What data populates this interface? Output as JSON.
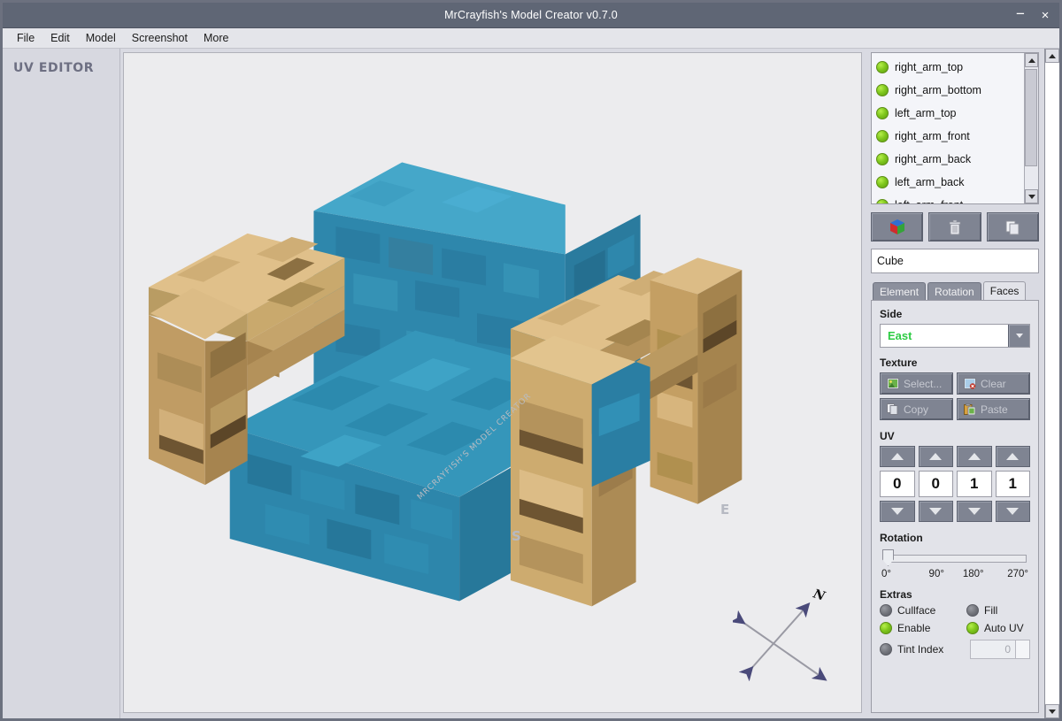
{
  "window": {
    "title": "MrCrayfish's Model Creator v0.7.0",
    "minimize": "−",
    "close": "×"
  },
  "menubar": {
    "items": [
      {
        "label": "File"
      },
      {
        "label": "Edit"
      },
      {
        "label": "Model"
      },
      {
        "label": "Screenshot"
      },
      {
        "label": "More"
      }
    ]
  },
  "sidebar": {
    "title": "UV EDITOR"
  },
  "viewport": {
    "watermark": "MRCRAYFISH'S MODEL CREATOR",
    "direction_south": "S",
    "direction_east": "E",
    "compass_north": "N",
    "model_colors": {
      "wool_top": "#3e9fc2",
      "wool_front": "#2d86ab",
      "wool_side": "#27789a",
      "wood_top": "#e0c08a",
      "wood_front": "#cfac72",
      "wood_side": "#a98c58",
      "wood_dark": "#6e5532",
      "background": "#ececee"
    }
  },
  "elements_list": {
    "items": [
      {
        "label": "right_arm_top",
        "enabled": true
      },
      {
        "label": "right_arm_bottom",
        "enabled": true
      },
      {
        "label": "left_arm_top",
        "enabled": true
      },
      {
        "label": "right_arm_front",
        "enabled": true
      },
      {
        "label": "right_arm_back",
        "enabled": true
      },
      {
        "label": "left_arm_back",
        "enabled": true
      },
      {
        "label": "left_arm_front",
        "enabled": true
      }
    ]
  },
  "toolbar": {
    "add_label": "add-cube",
    "delete_label": "delete-element",
    "copy_label": "copy-element"
  },
  "name_field": {
    "value": "Cube"
  },
  "tabs": [
    {
      "label": "Element",
      "active": false
    },
    {
      "label": "Rotation",
      "active": false
    },
    {
      "label": "Faces",
      "active": true
    }
  ],
  "faces_panel": {
    "side": {
      "label": "Side",
      "value": "East",
      "value_color": "#2ecc44"
    },
    "texture": {
      "label": "Texture",
      "buttons": [
        {
          "label": "Select...",
          "icon": "image-icon"
        },
        {
          "label": "Clear",
          "icon": "image-clear-icon"
        },
        {
          "label": "Copy",
          "icon": "copy-icon"
        },
        {
          "label": "Paste",
          "icon": "paste-icon"
        }
      ]
    },
    "uv": {
      "label": "UV",
      "values": [
        "0",
        "0",
        "1",
        "1"
      ]
    },
    "rotation": {
      "label": "Rotation",
      "ticks": [
        "0°",
        "90°",
        "180°",
        "270°"
      ],
      "value": "0°"
    },
    "extras": {
      "label": "Extras",
      "options": [
        {
          "label": "Cullface",
          "enabled": false
        },
        {
          "label": "Fill",
          "enabled": false
        },
        {
          "label": "Enable",
          "enabled": true
        },
        {
          "label": "Auto UV",
          "enabled": true
        },
        {
          "label": "Tint Index",
          "enabled": false
        }
      ],
      "tint_index_value": "0"
    }
  }
}
